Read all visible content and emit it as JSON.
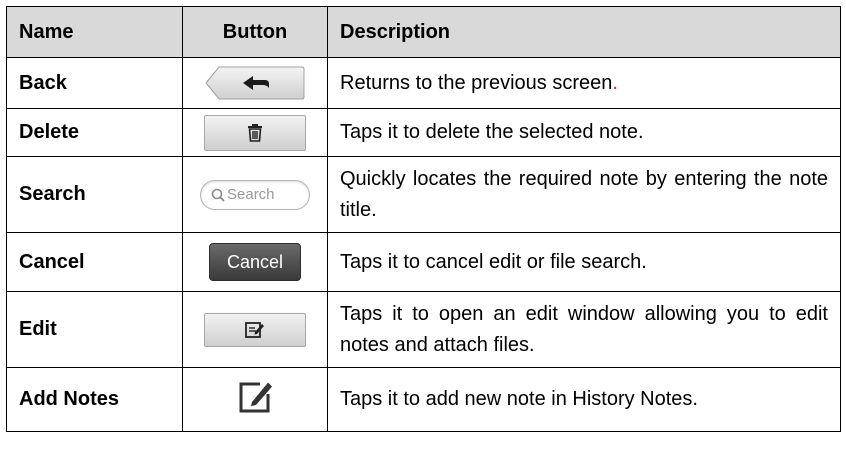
{
  "table": {
    "headers": {
      "name": "Name",
      "button": "Button",
      "description": "Description"
    },
    "rows": [
      {
        "name": "Back",
        "description": "Returns to the previous screen",
        "description_end": ".",
        "icon": "back-arrow-icon"
      },
      {
        "name": "Delete",
        "description": "Taps it to delete the selected note.",
        "icon": "trash-icon"
      },
      {
        "name": "Search",
        "description": "Quickly locates the required note by entering the note title.",
        "search_placeholder": "Search",
        "icon": "magnifier-icon"
      },
      {
        "name": "Cancel",
        "description": "Taps it to cancel edit or file search.",
        "cancel_label": "Cancel"
      },
      {
        "name": "Edit",
        "description": "Taps it to open an edit window allowing you to edit notes and attach files.",
        "icon": "edit-note-icon"
      },
      {
        "name": "Add Notes",
        "description": "Taps it to add new note in History Notes.",
        "icon": "add-note-pencil-icon"
      }
    ]
  },
  "colors": {
    "header_bg": "#d9d9d9",
    "cancel_bg": "#4a4a4a",
    "accent_period": "#c0392b"
  }
}
